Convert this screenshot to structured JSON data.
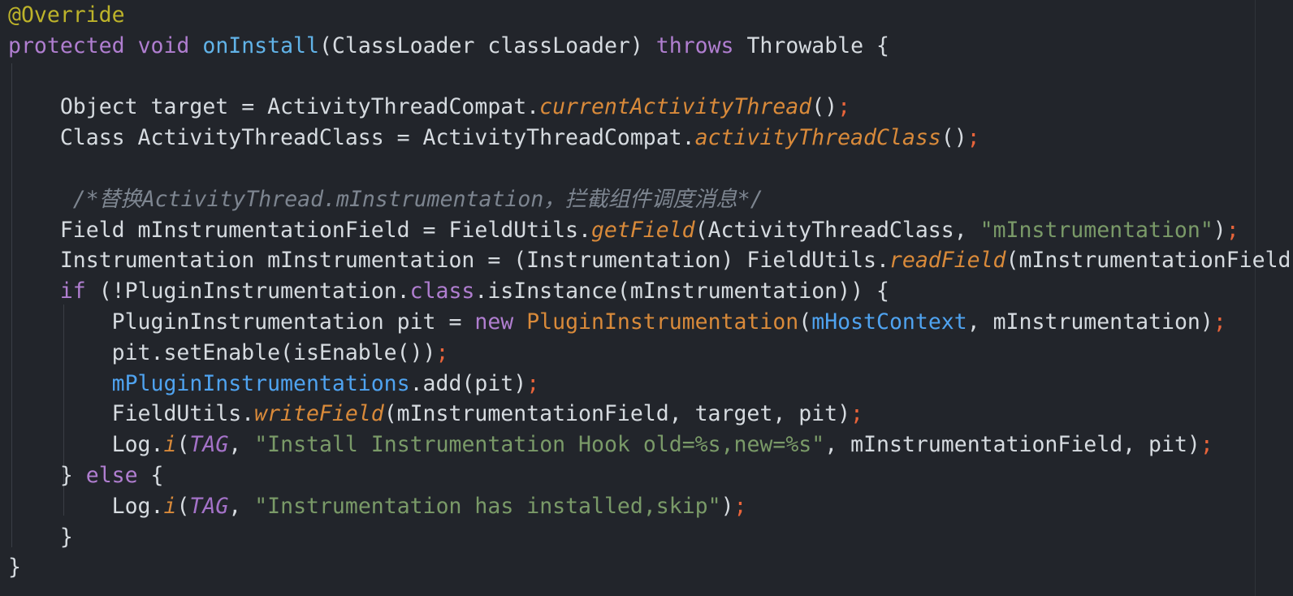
{
  "editor": {
    "lines": [
      {
        "indent": "",
        "tokens": [
          {
            "t": "@Override",
            "c": "ann"
          }
        ]
      },
      {
        "indent": "",
        "tokens": [
          {
            "t": "protected",
            "c": "kw"
          },
          {
            "t": " "
          },
          {
            "t": "void",
            "c": "kw"
          },
          {
            "t": " "
          },
          {
            "t": "onInstall",
            "c": "fn"
          },
          {
            "t": "(ClassLoader classLoader) "
          },
          {
            "t": "throws",
            "c": "kw"
          },
          {
            "t": " Throwable {"
          }
        ]
      },
      {
        "indent": "",
        "tokens": []
      },
      {
        "indent": "    ",
        "tokens": [
          {
            "t": "Object target = ActivityThreadCompat."
          },
          {
            "t": "currentActivityThread",
            "c": "call"
          },
          {
            "t": "()"
          },
          {
            "t": ";",
            "c": "semi"
          }
        ]
      },
      {
        "indent": "    ",
        "tokens": [
          {
            "t": "Class ActivityThreadClass = ActivityThreadCompat."
          },
          {
            "t": "activityThreadClass",
            "c": "call"
          },
          {
            "t": "()"
          },
          {
            "t": ";",
            "c": "semi"
          }
        ]
      },
      {
        "indent": "",
        "tokens": []
      },
      {
        "indent": "     ",
        "tokens": [
          {
            "t": "/*替换ActivityThread.mInstrumentation，拦截组件调度消息*/",
            "c": "cmt"
          }
        ]
      },
      {
        "indent": "    ",
        "tokens": [
          {
            "t": "Field mInstrumentationField = FieldUtils."
          },
          {
            "t": "getField",
            "c": "call"
          },
          {
            "t": "(ActivityThreadClass, "
          },
          {
            "t": "\"mInstrumentation\"",
            "c": "str"
          },
          {
            "t": ")"
          },
          {
            "t": ";",
            "c": "semi"
          }
        ]
      },
      {
        "indent": "    ",
        "tokens": [
          {
            "t": "Instrumentation mInstrumentation = (Instrumentation) FieldUtils."
          },
          {
            "t": "readField",
            "c": "call"
          },
          {
            "t": "(mInstrumentationField"
          }
        ]
      },
      {
        "indent": "    ",
        "tokens": [
          {
            "t": "if",
            "c": "kw"
          },
          {
            "t": " (!PluginInstrumentation."
          },
          {
            "t": "class",
            "c": "kw"
          },
          {
            "t": ".isInstance(mInstrumentation)) {"
          }
        ]
      },
      {
        "indent": "        ",
        "tokens": [
          {
            "t": "PluginInstrumentation pit = "
          },
          {
            "t": "new",
            "c": "kw"
          },
          {
            "t": " "
          },
          {
            "t": "PluginInstrumentation",
            "c": "ctor"
          },
          {
            "t": "("
          },
          {
            "t": "mHostContext",
            "c": "field"
          },
          {
            "t": ", mInstrumentation)"
          },
          {
            "t": ";",
            "c": "semi"
          }
        ]
      },
      {
        "indent": "        ",
        "tokens": [
          {
            "t": "pit.setEnable(isEnable())"
          },
          {
            "t": ";",
            "c": "semi"
          }
        ]
      },
      {
        "indent": "        ",
        "tokens": [
          {
            "t": "mPluginInstrumentations",
            "c": "field"
          },
          {
            "t": ".add(pit)"
          },
          {
            "t": ";",
            "c": "semi"
          }
        ]
      },
      {
        "indent": "        ",
        "tokens": [
          {
            "t": "FieldUtils."
          },
          {
            "t": "writeField",
            "c": "call"
          },
          {
            "t": "(mInstrumentationField, target, pit)"
          },
          {
            "t": ";",
            "c": "semi"
          }
        ]
      },
      {
        "indent": "        ",
        "tokens": [
          {
            "t": "Log."
          },
          {
            "t": "i",
            "c": "call"
          },
          {
            "t": "("
          },
          {
            "t": "TAG",
            "c": "const"
          },
          {
            "t": ", "
          },
          {
            "t": "\"Install Instrumentation Hook old=%s,new=%s\"",
            "c": "str"
          },
          {
            "t": ", mInstrumentationField, pit)"
          },
          {
            "t": ";",
            "c": "semi"
          }
        ]
      },
      {
        "indent": "    ",
        "tokens": [
          {
            "t": "} "
          },
          {
            "t": "else",
            "c": "kw"
          },
          {
            "t": " {"
          }
        ]
      },
      {
        "indent": "        ",
        "tokens": [
          {
            "t": "Log."
          },
          {
            "t": "i",
            "c": "call"
          },
          {
            "t": "("
          },
          {
            "t": "TAG",
            "c": "const"
          },
          {
            "t": ", "
          },
          {
            "t": "\"Instrumentation has installed,skip\"",
            "c": "str"
          },
          {
            "t": ")"
          },
          {
            "t": ";",
            "c": "semi"
          }
        ]
      },
      {
        "indent": "    ",
        "tokens": [
          {
            "t": "}"
          }
        ]
      },
      {
        "indent": "",
        "tokens": [
          {
            "t": "}"
          }
        ]
      }
    ]
  }
}
